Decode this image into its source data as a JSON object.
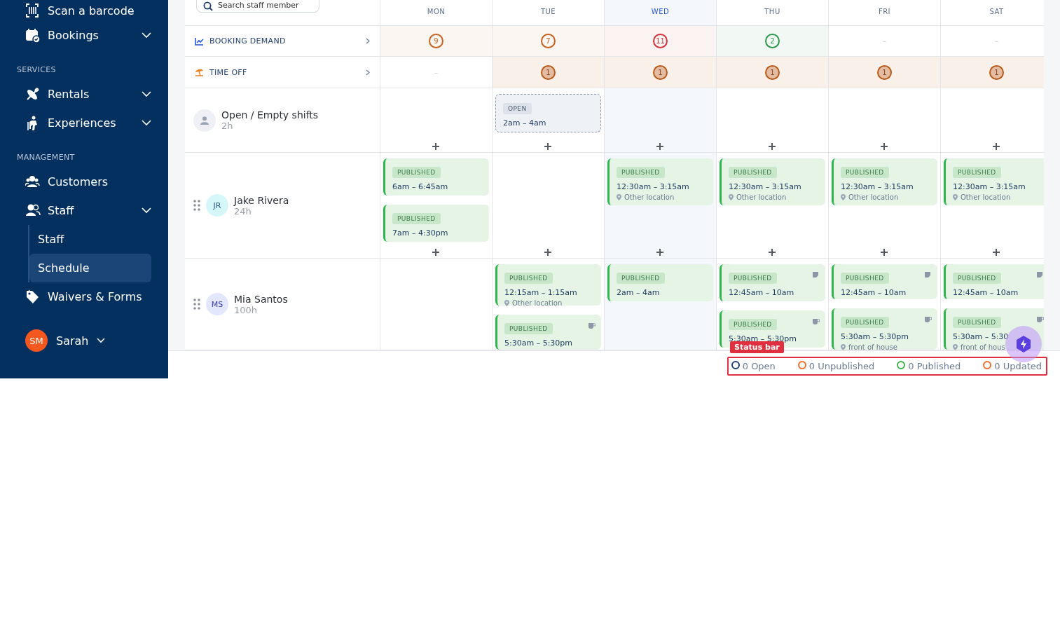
{
  "sidebar": {
    "sections": [
      {
        "items": [
          {
            "label": "Scan a barcode",
            "kind": "link"
          },
          {
            "label": "Bookings",
            "kind": "group"
          }
        ]
      },
      {
        "heading": "SERVICES",
        "items": [
          {
            "label": "Rentals",
            "kind": "group"
          },
          {
            "label": "Experiences",
            "kind": "group"
          }
        ]
      },
      {
        "heading": "MANAGEMENT",
        "items": [
          {
            "label": "Customers",
            "kind": "link"
          },
          {
            "label": "Staff",
            "kind": "group",
            "children": [
              {
                "label": "Staff",
                "selected": false
              },
              {
                "label": "Schedule",
                "selected": true
              }
            ]
          },
          {
            "label": "Waivers & Forms",
            "kind": "link"
          }
        ]
      }
    ],
    "user": {
      "initials": "SM",
      "name": "Sarah"
    }
  },
  "schedule": {
    "search": {
      "placeholder": "Search staff member"
    },
    "days": [
      {
        "label": "MON",
        "selected": false
      },
      {
        "label": "TUE",
        "selected": false
      },
      {
        "label": "WED",
        "selected": true
      },
      {
        "label": "THU",
        "selected": false
      },
      {
        "label": "FRI",
        "selected": false
      },
      {
        "label": "SAT",
        "selected": false
      }
    ],
    "booking_demand": {
      "label": "BOOKING DEMAND",
      "cells": [
        {
          "value": "9",
          "color": "#c8611f"
        },
        {
          "value": "7",
          "color": "#c8611f"
        },
        {
          "value": "11",
          "color": "#d5323a"
        },
        {
          "value": "2",
          "color": "#2a9a4a"
        },
        {
          "value": "–"
        },
        {
          "value": "–"
        }
      ]
    },
    "time_off": {
      "label": "TIME OFF",
      "cells": [
        {
          "value": "–"
        },
        {
          "value": "1",
          "color": "#b85a1a"
        },
        {
          "value": "1",
          "color": "#b85a1a"
        },
        {
          "value": "1",
          "color": "#b85a1a"
        },
        {
          "value": "1",
          "color": "#b85a1a"
        },
        {
          "value": "1",
          "color": "#b85a1a"
        }
      ]
    },
    "rows": [
      {
        "kind": "open",
        "name": "Open / Empty shifts",
        "hours": "2h",
        "cells": [
          [],
          [
            {
              "status": "OPEN",
              "kind": "open",
              "time": "2am – 4am"
            }
          ],
          [],
          [],
          [],
          []
        ]
      },
      {
        "kind": "staff",
        "initials": "JR",
        "color": "#d6f7fa",
        "name": "Jake Rivera",
        "hours": "24h",
        "cells": [
          [
            {
              "status": "PUBLISHED",
              "kind": "published",
              "time": "6am – 6:45am"
            },
            {
              "status": "PUBLISHED",
              "kind": "published",
              "time": "7am – 4:30pm"
            }
          ],
          [],
          [
            {
              "status": "PUBLISHED",
              "kind": "published",
              "time": "12:30am – 3:15am",
              "location": "Other location"
            }
          ],
          [
            {
              "status": "PUBLISHED",
              "kind": "published",
              "time": "12:30am – 3:15am",
              "location": "Other location"
            }
          ],
          [
            {
              "status": "PUBLISHED",
              "kind": "published",
              "time": "12:30am – 3:15am",
              "location": "Other location"
            }
          ],
          [
            {
              "status": "PUBLISHED",
              "kind": "published",
              "time": "12:30am – 3:15am",
              "location": "Other location"
            }
          ]
        ]
      },
      {
        "kind": "staff",
        "initials": "MS",
        "color": "#e3e7fd",
        "name": "Mia Santos",
        "hours": "100h",
        "cells": [
          [],
          [
            {
              "status": "PUBLISHED",
              "kind": "published",
              "time": "12:15am – 1:15am",
              "location": "Other location"
            },
            {
              "status": "PUBLISHED",
              "kind": "published",
              "time": "5:30am – 5:30pm",
              "break": true
            }
          ],
          [
            {
              "status": "PUBLISHED",
              "kind": "published",
              "time": "2am – 4am"
            }
          ],
          [
            {
              "status": "PUBLISHED",
              "kind": "published",
              "time": "12:45am – 10am",
              "has_note": true
            },
            {
              "status": "PUBLISHED",
              "kind": "published",
              "time": "5:30am – 5:30pm",
              "break": true
            }
          ],
          [
            {
              "status": "PUBLISHED",
              "kind": "published",
              "time": "12:45am – 10am",
              "has_note": true
            },
            {
              "status": "PUBLISHED",
              "kind": "published",
              "time": "5:30am – 5:30pm",
              "location": "front of house",
              "break": true
            }
          ],
          [
            {
              "status": "PUBLISHED",
              "kind": "published",
              "time": "12:45am – 10am",
              "has_note": true
            },
            {
              "status": "PUBLISHED",
              "kind": "published",
              "time": "5:30am – 5:30",
              "location": "front of hous",
              "break": true
            }
          ]
        ]
      }
    ]
  },
  "status_bar": {
    "annotation": "Status bar",
    "items": [
      {
        "label": "0 Open",
        "color": "#1f3f6e"
      },
      {
        "label": "0 Unpublished",
        "color": "#f26b2b"
      },
      {
        "label": "0 Published",
        "color": "#3cb54a"
      },
      {
        "label": "0 Updated",
        "color": "#f26b2b"
      }
    ]
  }
}
